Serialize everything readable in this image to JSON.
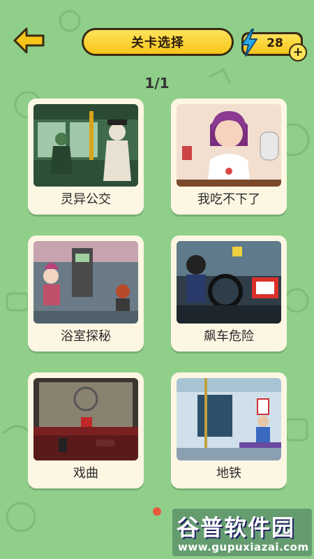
{
  "header": {
    "title": "关卡选择",
    "coins": "28",
    "plus": "+"
  },
  "pagination": {
    "text": "1/1"
  },
  "levels": [
    {
      "label": "灵异公交"
    },
    {
      "label": "我吃不下了"
    },
    {
      "label": "浴室探秘"
    },
    {
      "label": "飙车危险"
    },
    {
      "label": "戏曲"
    },
    {
      "label": "地铁"
    }
  ],
  "watermark": {
    "title": "谷普软件园",
    "url": "www.gupuxiazai.com"
  },
  "colors": {
    "background": "#8fcf8a",
    "accent": "#f6c51a",
    "card": "#fdf6e3",
    "dot": "#e85a3c"
  }
}
